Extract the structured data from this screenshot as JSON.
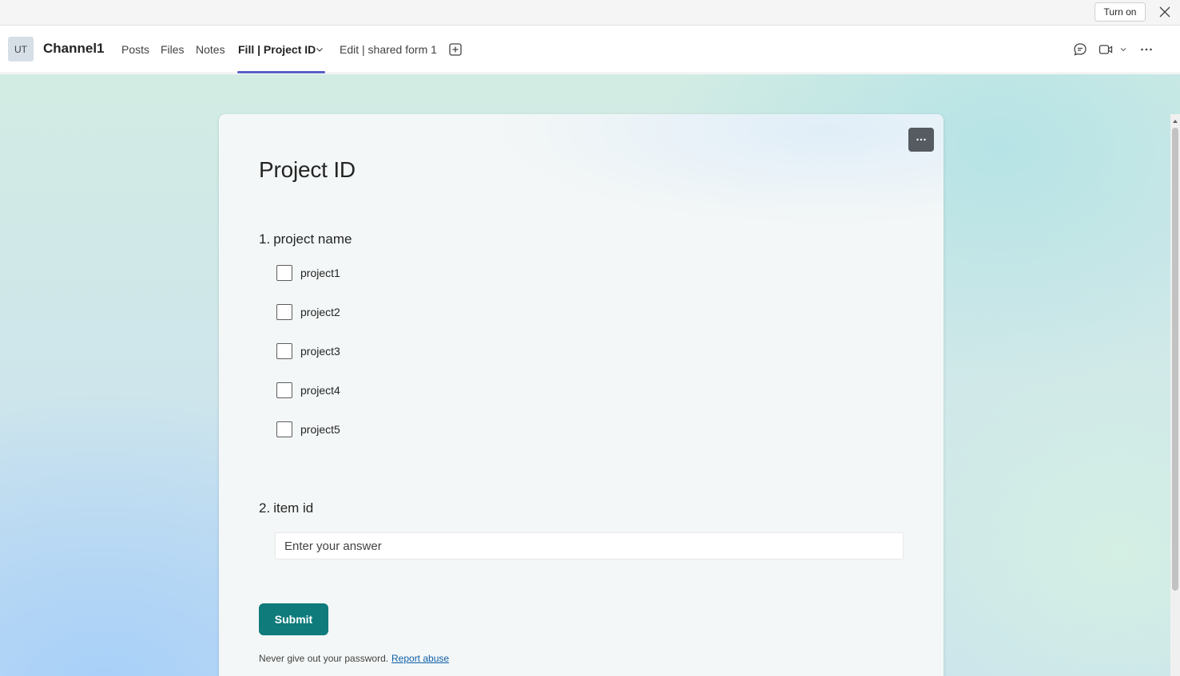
{
  "notification": {
    "turn_on_label": "Turn on"
  },
  "header": {
    "avatar_initials": "UT",
    "channel_name": "Channel1",
    "tabs": [
      {
        "label": "Posts"
      },
      {
        "label": "Files"
      },
      {
        "label": "Notes"
      },
      {
        "label": "Fill | Project ID",
        "active": true
      },
      {
        "label": "Edit | shared form 1"
      }
    ],
    "icons": [
      "chat-icon",
      "video-icon",
      "more-icon"
    ]
  },
  "form": {
    "title": "Project ID",
    "questions": [
      {
        "number": "1.",
        "title": "project name",
        "type": "checkbox",
        "options": [
          "project1",
          "project2",
          "project3",
          "project4",
          "project5"
        ]
      },
      {
        "number": "2.",
        "title": "item id",
        "type": "text",
        "placeholder": "Enter your answer",
        "value": ""
      }
    ],
    "submit_label": "Submit",
    "footer_note": "Never give out your password.",
    "report_link": "Report abuse"
  },
  "colors": {
    "accent_tab": "#5b5fc7",
    "submit_bg": "#0f7b7b",
    "link": "#0f5fa8"
  }
}
